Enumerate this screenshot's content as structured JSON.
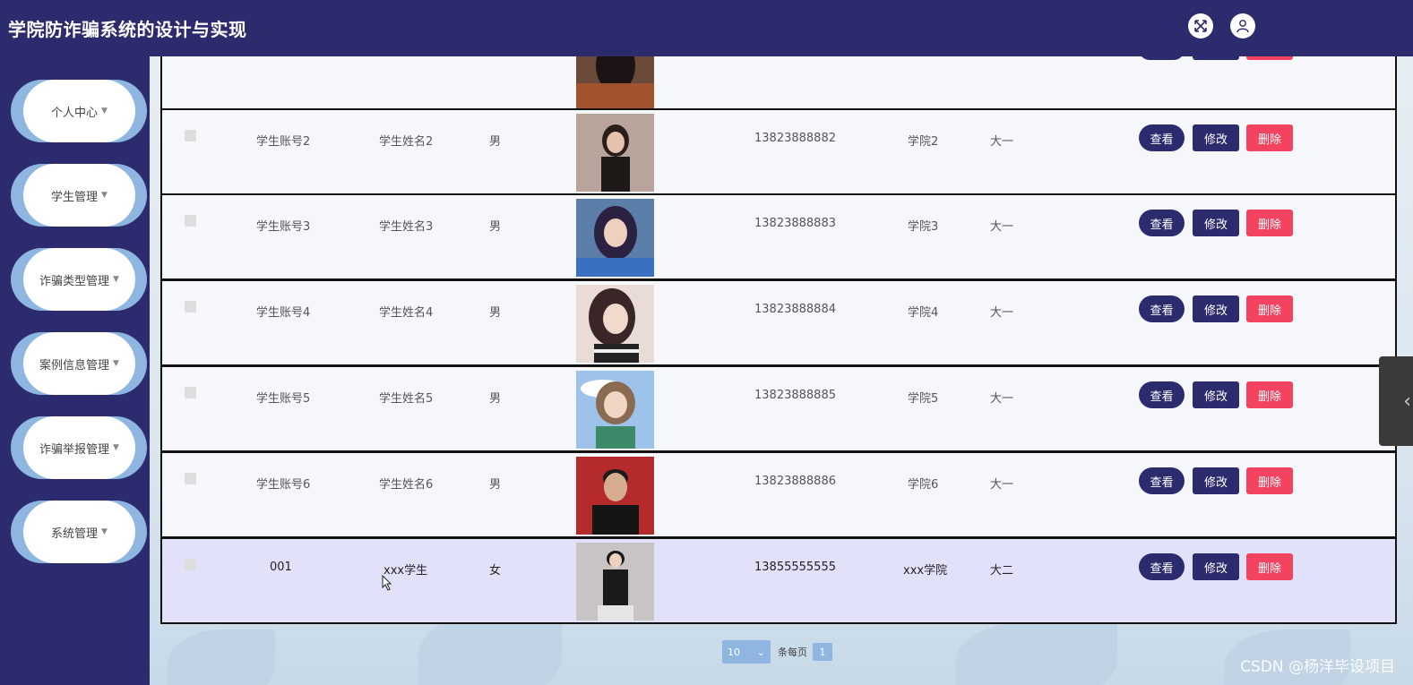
{
  "app": {
    "title": "学院防诈骗系统的设计与实现"
  },
  "header_icons": [
    "fullscreen-icon",
    "user-icon"
  ],
  "sidebar": {
    "items": [
      {
        "label": "个人中心"
      },
      {
        "label": "学生管理"
      },
      {
        "label": "诈骗类型管理"
      },
      {
        "label": "案例信息管理"
      },
      {
        "label": "诈骗举报管理"
      },
      {
        "label": "系统管理"
      }
    ]
  },
  "table": {
    "buttons": {
      "view": "查看",
      "edit": "修改",
      "delete": "删除"
    },
    "rows": [
      {
        "account": "学生账号2",
        "name": "学生姓名2",
        "gender": "男",
        "phone": "13823888882",
        "college": "学院2",
        "grade": "大一"
      },
      {
        "account": "学生账号3",
        "name": "学生姓名3",
        "gender": "男",
        "phone": "13823888883",
        "college": "学院3",
        "grade": "大一"
      },
      {
        "account": "学生账号4",
        "name": "学生姓名4",
        "gender": "男",
        "phone": "13823888884",
        "college": "学院4",
        "grade": "大一"
      },
      {
        "account": "学生账号5",
        "name": "学生姓名5",
        "gender": "男",
        "phone": "13823888885",
        "college": "学院5",
        "grade": "大一"
      },
      {
        "account": "学生账号6",
        "name": "学生姓名6",
        "gender": "男",
        "phone": "13823888886",
        "college": "学院6",
        "grade": "大一"
      },
      {
        "account": "001",
        "name": "xxx学生",
        "gender": "女",
        "phone": "13855555555",
        "college": "xxx学院",
        "grade": "大二"
      }
    ]
  },
  "pagination": {
    "page_size": "10",
    "per_page_label": "条每页",
    "current_page": "1"
  },
  "watermark": "CSDN @杨洋毕设项目",
  "colors": {
    "primary": "#2c2b6e",
    "danger": "#f44360",
    "accent": "#8fb6e0"
  }
}
